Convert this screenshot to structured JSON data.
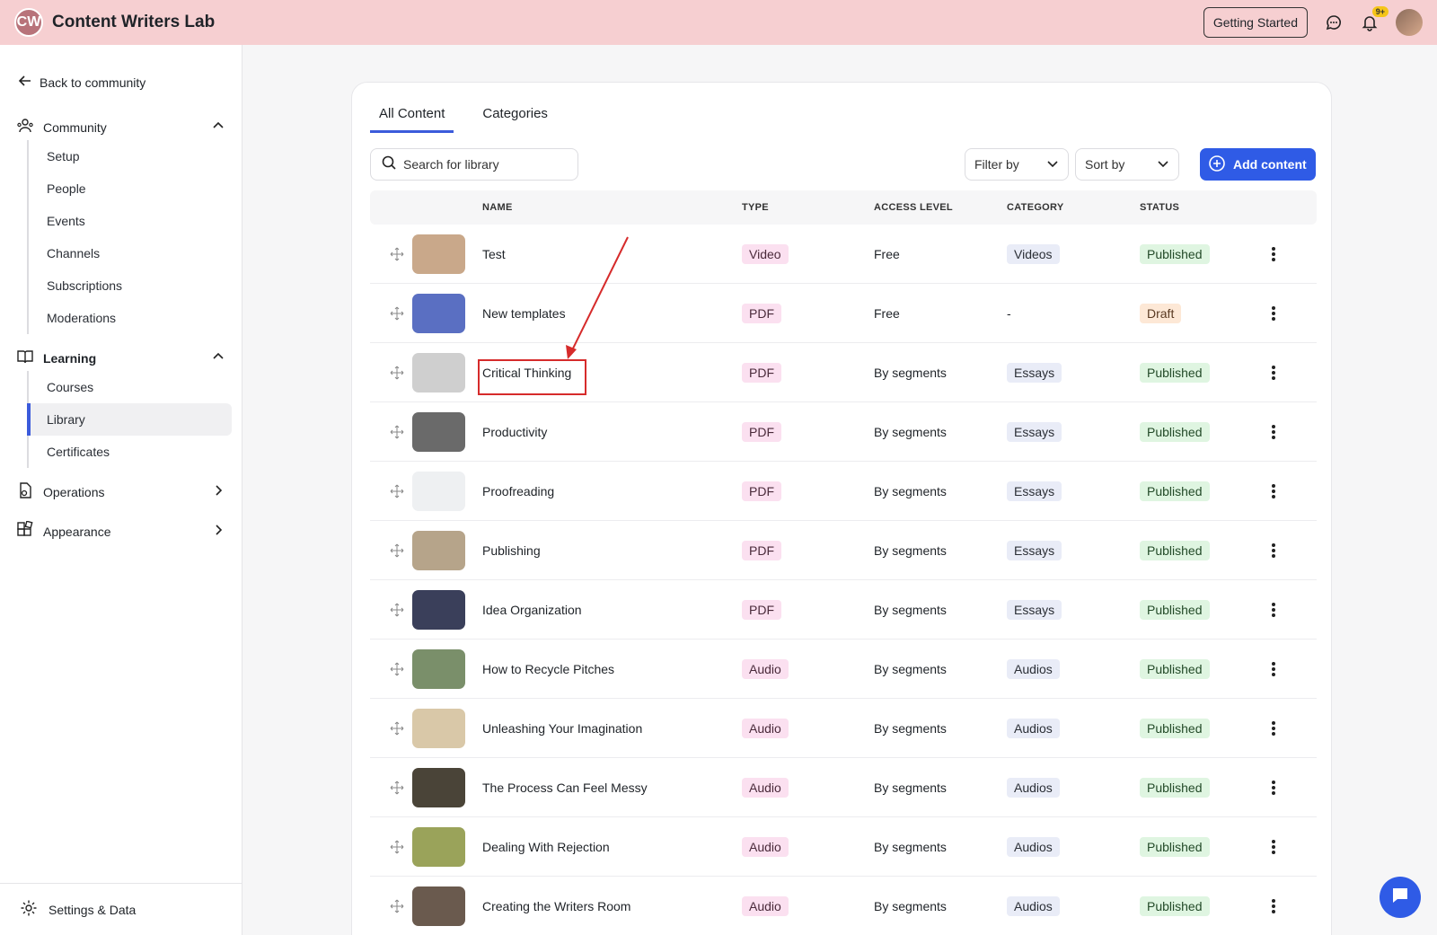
{
  "app": {
    "logo_text": "CW",
    "title": "Content Writers Lab"
  },
  "header": {
    "getting_started_label": "Getting Started",
    "notifications_badge": "9+"
  },
  "sidebar": {
    "back_label": "Back to community",
    "community": {
      "label": "Community",
      "items": [
        "Setup",
        "People",
        "Events",
        "Channels",
        "Subscriptions",
        "Moderations"
      ]
    },
    "learning": {
      "label": "Learning",
      "items": [
        "Courses",
        "Library",
        "Certificates"
      ],
      "active": "Library"
    },
    "operations_label": "Operations",
    "appearance_label": "Appearance",
    "settings_label": "Settings & Data"
  },
  "main": {
    "tabs": [
      "All Content",
      "Categories"
    ],
    "active_tab": "All Content",
    "search_placeholder": "Search for library",
    "filter_label": "Filter by",
    "sort_label": "Sort by",
    "add_label": "Add content",
    "columns": [
      "NAME",
      "TYPE",
      "ACCESS LEVEL",
      "CATEGORY",
      "STATUS"
    ],
    "rows": [
      {
        "name": "Test",
        "type": "Video",
        "access": "Free",
        "category": "Videos",
        "status": "Published",
        "thumb": "#c9a88a"
      },
      {
        "name": "New templates",
        "type": "PDF",
        "access": "Free",
        "category": "-",
        "status": "Draft",
        "thumb": "#5a6fc2"
      },
      {
        "name": "Critical Thinking",
        "type": "PDF",
        "access": "By segments",
        "category": "Essays",
        "status": "Published",
        "thumb": "#cfcfcf"
      },
      {
        "name": "Productivity",
        "type": "PDF",
        "access": "By segments",
        "category": "Essays",
        "status": "Published",
        "thumb": "#6a6a6a"
      },
      {
        "name": "Proofreading",
        "type": "PDF",
        "access": "By segments",
        "category": "Essays",
        "status": "Published",
        "thumb": "#eef0f2"
      },
      {
        "name": "Publishing",
        "type": "PDF",
        "access": "By segments",
        "category": "Essays",
        "status": "Published",
        "thumb": "#b6a48a"
      },
      {
        "name": "Idea Organization",
        "type": "PDF",
        "access": "By segments",
        "category": "Essays",
        "status": "Published",
        "thumb": "#3a3f5a"
      },
      {
        "name": "How to Recycle Pitches",
        "type": "Audio",
        "access": "By segments",
        "category": "Audios",
        "status": "Published",
        "thumb": "#7a8f6a"
      },
      {
        "name": "Unleashing Your Imagination",
        "type": "Audio",
        "access": "By segments",
        "category": "Audios",
        "status": "Published",
        "thumb": "#d9c8a8"
      },
      {
        "name": "The Process Can Feel Messy",
        "type": "Audio",
        "access": "By segments",
        "category": "Audios",
        "status": "Published",
        "thumb": "#4a4438"
      },
      {
        "name": "Dealing With Rejection",
        "type": "Audio",
        "access": "By segments",
        "category": "Audios",
        "status": "Published",
        "thumb": "#9aa35a"
      },
      {
        "name": "Creating the Writers Room",
        "type": "Audio",
        "access": "By segments",
        "category": "Audios",
        "status": "Published",
        "thumb": "#6a5a4e"
      }
    ]
  },
  "colors": {
    "topbar": "#f6cfd1",
    "accent": "#2f5be6",
    "annotation": "#d62b2b"
  }
}
